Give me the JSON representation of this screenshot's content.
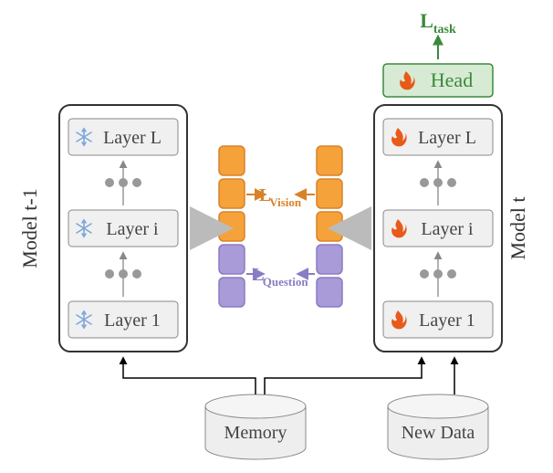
{
  "left_model": {
    "label": "Model t-1",
    "layers": [
      "Layer L",
      "Layer i",
      "Layer 1"
    ],
    "icon": "snowflake"
  },
  "right_model": {
    "label": "Model t",
    "layers": [
      "Layer L",
      "Layer i",
      "Layer 1"
    ],
    "icon": "flame"
  },
  "head": {
    "label": "Head",
    "icon": "flame"
  },
  "losses": {
    "task": "L",
    "task_sub": "task",
    "vision": "L",
    "vision_sub": "Vision",
    "question": "L",
    "question_sub": "Question"
  },
  "memory": "Memory",
  "new_data": "New Data",
  "colors": {
    "orange": "#f5a23a",
    "orange_stroke": "#d9822b",
    "purple": "#a99ad8",
    "purple_stroke": "#8a7cc4",
    "green": "#3a8a3a",
    "green_fill": "#d7ebd4",
    "gray_box": "#f0f0f0",
    "gray_stroke": "#888",
    "gray_dark": "#555",
    "snowflake": "#7ea6d9"
  }
}
